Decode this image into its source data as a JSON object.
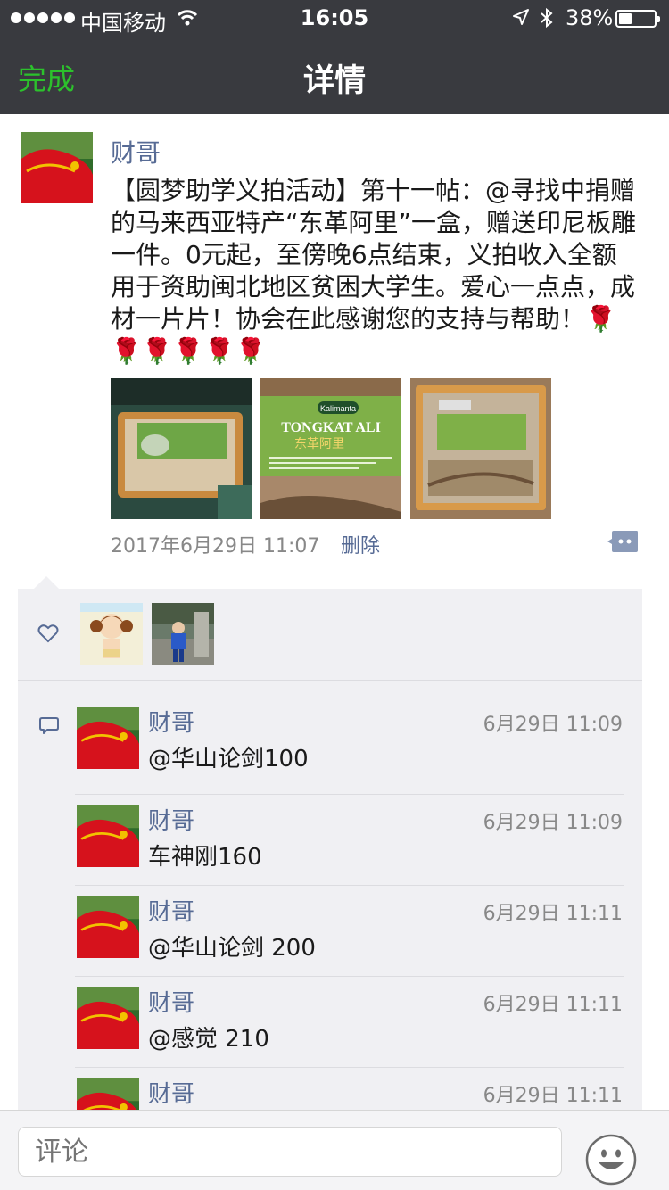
{
  "status_bar": {
    "carrier": "中国移动",
    "time": "16:05",
    "battery": "38%",
    "battery_level": 0.38
  },
  "nav": {
    "done_label": "完成",
    "title": "详情"
  },
  "post": {
    "author": "财哥",
    "text": "【圆梦助学义拍活动】第十一帖：@寻找中捐赠的马来西亚特产“东革阿里”一盒，赠送印尼板雕一件。0元起，至傍晚6点结束，义拍收入全额用于资助闽北地区贫困大学生。爱心一点点，成材一片片！协会在此感谢您的支持与帮助！🌹🌹🌹🌹🌹🌹",
    "photos": [
      {
        "brand": "",
        "title": ""
      },
      {
        "brand": "Kalimanta",
        "title": "TONGKAT ALI",
        "subtitle": "东革阿里"
      },
      {
        "brand": "",
        "title": ""
      }
    ],
    "timestamp": "2017年6月29日 11:07",
    "delete_label": "删除"
  },
  "comments": [
    {
      "name": "财哥",
      "time": "6月29日 11:09",
      "text": "@华山论剑100"
    },
    {
      "name": "财哥",
      "time": "6月29日 11:09",
      "text": "车神刚160"
    },
    {
      "name": "财哥",
      "time": "6月29日 11:11",
      "text": "@华山论剑 200"
    },
    {
      "name": "财哥",
      "time": "6月29日 11:11",
      "text": "@感觉 210"
    },
    {
      "name": "财哥",
      "time": "6月29日 11:11",
      "text": ""
    }
  ],
  "input": {
    "placeholder": "评论"
  },
  "colors": {
    "nav_bg": "#393a3f",
    "accent_green": "#2cc12c",
    "link_blue": "#576b95"
  }
}
